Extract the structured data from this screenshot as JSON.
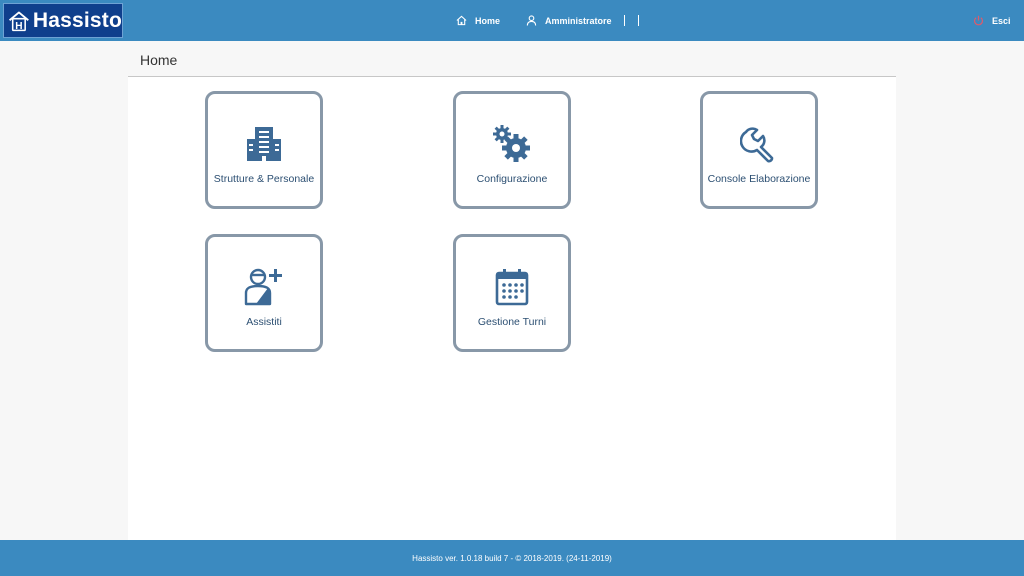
{
  "header": {
    "app_name": "Hassisto",
    "logo_letter": "H",
    "nav": {
      "home_label": "Home",
      "admin_label": "Amministratore",
      "exit_label": "Esci"
    },
    "colors": {
      "bar": "#3b8ac0",
      "logo_bg": "#0f3f8c",
      "exit_icon": "#e05a6a"
    }
  },
  "page": {
    "title": "Home",
    "tiles": [
      {
        "label": "Strutture & Personale",
        "icon": "building-icon"
      },
      {
        "label": "Configurazione",
        "icon": "gears-icon"
      },
      {
        "label": "Console Elaborazione",
        "icon": "wrench-icon"
      },
      {
        "label": "Assistiti",
        "icon": "patient-add-icon"
      },
      {
        "label": "Gestione Turni",
        "icon": "calendar-icon"
      }
    ]
  },
  "footer": {
    "text": "Hassisto ver. 1.0.18 build 7 - © 2018-2019. (24-11-2019)"
  }
}
